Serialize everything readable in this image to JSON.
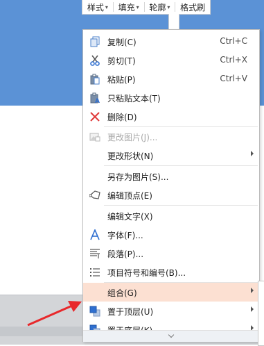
{
  "mini_toolbar": {
    "items": [
      "样式",
      "填充",
      "轮廓",
      "格式刷"
    ]
  },
  "menu": {
    "items": [
      {
        "label": "复制(C)",
        "shortcut": "Ctrl+C",
        "icon": "copy-icon"
      },
      {
        "label": "剪切(T)",
        "shortcut": "Ctrl+X",
        "icon": "scissors-icon"
      },
      {
        "label": "粘贴(P)",
        "shortcut": "Ctrl+V",
        "icon": "paste-icon"
      },
      {
        "label": "只粘贴文本(T)",
        "shortcut": "",
        "icon": "paste-text-icon"
      },
      {
        "label": "删除(D)",
        "shortcut": "",
        "icon": "delete-x-icon"
      },
      {
        "label": "更改图片(J)...",
        "shortcut": "",
        "icon": "change-picture-icon",
        "disabled": true
      },
      {
        "label": "更改形状(N)",
        "shortcut": "",
        "submenu": true
      },
      {
        "label": "另存为图片(S)...",
        "shortcut": ""
      },
      {
        "label": "编辑顶点(E)",
        "shortcut": "",
        "icon": "edit-points-icon"
      },
      {
        "label": "编辑文字(X)",
        "shortcut": ""
      },
      {
        "label": "字体(F)...",
        "shortcut": "",
        "icon": "font-icon"
      },
      {
        "label": "段落(P)...",
        "shortcut": "",
        "icon": "paragraph-icon"
      },
      {
        "label": "项目符号和编号(B)...",
        "shortcut": "",
        "icon": "bullets-icon"
      },
      {
        "label": "组合(G)",
        "shortcut": "",
        "submenu": true,
        "highlighted": true
      },
      {
        "label": "置于顶层(U)",
        "shortcut": "",
        "submenu": true,
        "icon": "bring-to-front-icon"
      },
      {
        "label": "置于底层(K)",
        "shortcut": "",
        "submenu": true,
        "icon": "send-to-back-icon"
      }
    ]
  },
  "colors": {
    "canvas_shape": "#5b92d6",
    "highlight": "#fce0d2",
    "annotation_arrow": "#e8282b",
    "accent_icon": "#2f6fd0"
  }
}
